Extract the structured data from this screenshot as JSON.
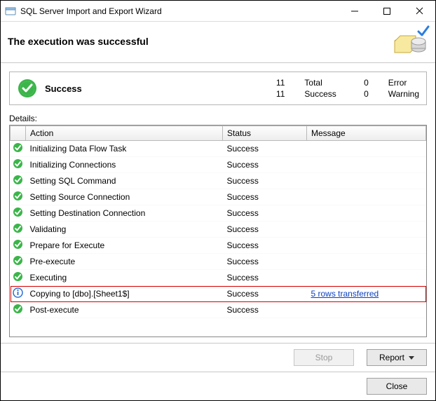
{
  "window": {
    "title": "SQL Server Import and Export Wizard"
  },
  "header": {
    "headline": "The execution was successful"
  },
  "summary": {
    "label": "Success",
    "total_count": "11",
    "total_label": "Total",
    "success_count": "11",
    "success_label": "Success",
    "error_count": "0",
    "error_label": "Error",
    "warning_count": "0",
    "warning_label": "Warning"
  },
  "details_label": "Details:",
  "columns": {
    "action": "Action",
    "status": "Status",
    "message": "Message"
  },
  "rows": [
    {
      "icon": "check",
      "action": "Initializing Data Flow Task",
      "status": "Success",
      "message": "",
      "msg_is_link": false,
      "highlight": false
    },
    {
      "icon": "check",
      "action": "Initializing Connections",
      "status": "Success",
      "message": "",
      "msg_is_link": false,
      "highlight": false
    },
    {
      "icon": "check",
      "action": "Setting SQL Command",
      "status": "Success",
      "message": "",
      "msg_is_link": false,
      "highlight": false
    },
    {
      "icon": "check",
      "action": "Setting Source Connection",
      "status": "Success",
      "message": "",
      "msg_is_link": false,
      "highlight": false
    },
    {
      "icon": "check",
      "action": "Setting Destination Connection",
      "status": "Success",
      "message": "",
      "msg_is_link": false,
      "highlight": false
    },
    {
      "icon": "check",
      "action": "Validating",
      "status": "Success",
      "message": "",
      "msg_is_link": false,
      "highlight": false
    },
    {
      "icon": "check",
      "action": "Prepare for Execute",
      "status": "Success",
      "message": "",
      "msg_is_link": false,
      "highlight": false
    },
    {
      "icon": "check",
      "action": "Pre-execute",
      "status": "Success",
      "message": "",
      "msg_is_link": false,
      "highlight": false
    },
    {
      "icon": "check",
      "action": "Executing",
      "status": "Success",
      "message": "",
      "msg_is_link": false,
      "highlight": false
    },
    {
      "icon": "info",
      "action": "Copying to [dbo].[Sheet1$]",
      "status": "Success",
      "message": "5 rows transferred",
      "msg_is_link": true,
      "highlight": true
    },
    {
      "icon": "check",
      "action": "Post-execute",
      "status": "Success",
      "message": "",
      "msg_is_link": false,
      "highlight": false
    }
  ],
  "buttons": {
    "stop": "Stop",
    "report": "Report",
    "close": "Close"
  }
}
